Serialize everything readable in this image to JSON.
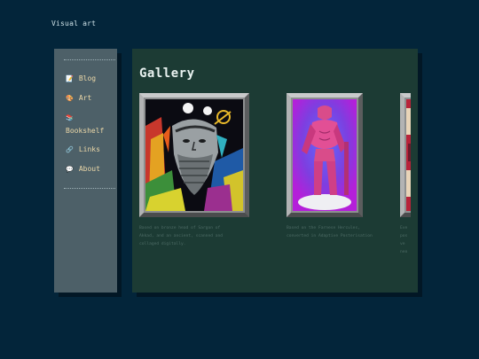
{
  "site": {
    "title": "Visual art"
  },
  "sidebar": {
    "items": [
      {
        "label": "Blog",
        "icon": "memo-icon",
        "glyph": "📝"
      },
      {
        "label": "Art",
        "icon": "palette-icon",
        "glyph": "🎨"
      },
      {
        "label": "Bookshelf",
        "icon": "books-icon",
        "glyph": "📚"
      },
      {
        "label": "Links",
        "icon": "link-icon",
        "glyph": "🔗"
      },
      {
        "label": "About",
        "icon": "speech-bubble-icon",
        "glyph": "💬"
      }
    ]
  },
  "gallery": {
    "title": "Gallery",
    "items": [
      {
        "caption_lines": [
          "Based on bronze head of Sargon of",
          "Akkad, and an ancient, scanned and",
          "collaged digitally."
        ]
      },
      {
        "caption_lines": [
          "Based on the Farnese Hercules,",
          "converted in Adaptive Posterisation"
        ]
      },
      {
        "caption_lines": [
          "Eve",
          "pos",
          "ve",
          "neo"
        ]
      }
    ]
  },
  "colors": {
    "background": "#03253a",
    "sidebar": "#4d6068",
    "panel": "#1c3b34",
    "nav_text": "#ecd8a8"
  }
}
